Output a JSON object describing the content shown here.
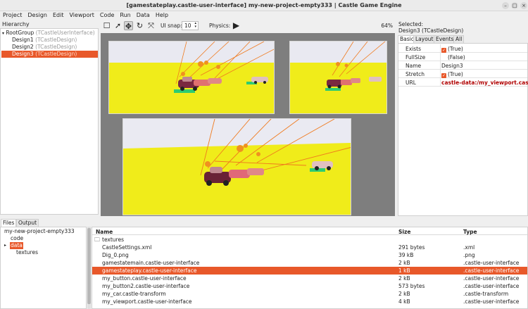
{
  "window": {
    "title": "[gamestateplay.castle-user-interface] my-new-project-empty333 | Castle Game Engine",
    "minimize_glyph": "–",
    "maximize_glyph": "□",
    "close_glyph": "×"
  },
  "menu": [
    "Project",
    "Design",
    "Edit",
    "Viewport",
    "Code",
    "Run",
    "Data",
    "Help"
  ],
  "hierarchy": {
    "label": "Hierarchy",
    "nodes": [
      {
        "name": "RootGroup",
        "cls": "(TCastleUserInterface)"
      },
      {
        "name": "Design1",
        "cls": "(TCastleDesign)"
      },
      {
        "name": "Design2",
        "cls": "(TCastleDesign)"
      },
      {
        "name": "Design3",
        "cls": "(TCastleDesign)"
      }
    ],
    "selected_index": 3
  },
  "toolbar": {
    "ui_snap_label": "UI snap:",
    "ui_snap_value": "10",
    "physics_label": "Physics:",
    "zoom": "64%"
  },
  "inspector": {
    "selected_label": "Selected:",
    "selected_value": "Design3 (TCastleDesign)",
    "tabs": [
      "Basic",
      "Layout",
      "Events",
      "All"
    ],
    "active_tab": "Basic",
    "properties": [
      {
        "name": "Exists",
        "value": "(True)",
        "checked": true
      },
      {
        "name": "FullSize",
        "value": "(False)",
        "checked": false
      },
      {
        "name": "Name",
        "value": "Design3"
      },
      {
        "name": "Stretch",
        "value": "(True)",
        "checked": true
      },
      {
        "name": "URL",
        "value": "castle-data:/my_viewport.castle"
      }
    ]
  },
  "bottom_tabs": [
    "Files",
    "Output"
  ],
  "file_tree": {
    "root": "my-new-project-empty333",
    "items": [
      "code",
      "data",
      "textures"
    ],
    "selected": "data"
  },
  "file_list": {
    "headers": {
      "name": "Name",
      "size": "Size",
      "type": "Type"
    },
    "rows": [
      {
        "name": "textures",
        "size": "",
        "type": ""
      },
      {
        "name": "CastleSettings.xml",
        "size": "291 bytes",
        "type": ".xml"
      },
      {
        "name": "Dig_0.png",
        "size": "39 kB",
        "type": ".png"
      },
      {
        "name": "gamestatemain.castle-user-interface",
        "size": "2 kB",
        "type": ".castle-user-interface"
      },
      {
        "name": "gamestateplay.castle-user-interface",
        "size": "1 kB",
        "type": ".castle-user-interface"
      },
      {
        "name": "my_button.castle-user-interface",
        "size": "2 kB",
        "type": ".castle-user-interface"
      },
      {
        "name": "my_button2.castle-user-interface",
        "size": "573 bytes",
        "type": ".castle-user-interface"
      },
      {
        "name": "my_car.castle-transform",
        "size": "2 kB",
        "type": ".castle-transform"
      },
      {
        "name": "my_viewport.castle-user-interface",
        "size": "4 kB",
        "type": ".castle-user-interface"
      }
    ],
    "selected_index": 4
  },
  "colors": {
    "accent": "#e8582a",
    "ground": "#f0ec1a",
    "sky": "#eaeaf2"
  }
}
